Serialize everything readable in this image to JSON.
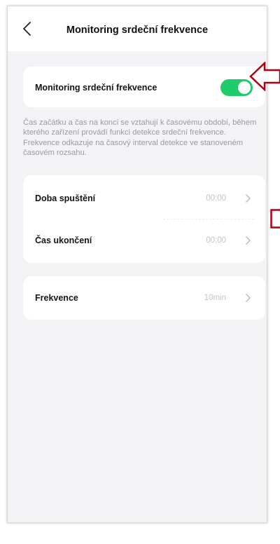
{
  "header": {
    "title": "Monitoring srdeční frekvence"
  },
  "icons": {
    "back": "chevron-left-icon",
    "row_arrow": "chevron-right-icon"
  },
  "toggle_card": {
    "label": "Monitoring srdeční frekvence",
    "enabled": true
  },
  "description": "Čas začátku a čas na konci se vztahují k časovému období, během kterého zařízení provádí funkci detekce srdeční frekvence. Frekvence odkazuje na časový interval detekce ve stanoveném časovém rozsahu.",
  "time_card": {
    "rows": [
      {
        "label": "Doba spuštění",
        "value": "00:00"
      },
      {
        "label": "Čas ukončení",
        "value": "00:00"
      }
    ]
  },
  "frequency_card": {
    "label": "Frekvence",
    "value": "10min"
  },
  "colors": {
    "toggle_on": "#1fcb6a",
    "annotation": "#b0000f",
    "background": "#f3f3f5"
  }
}
